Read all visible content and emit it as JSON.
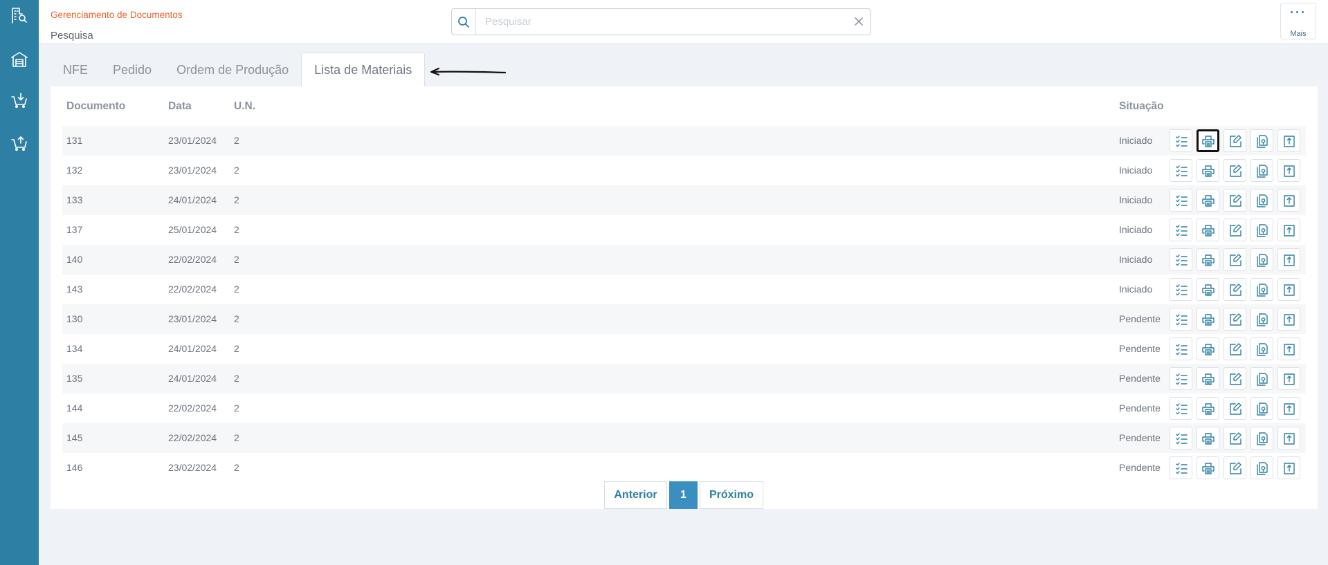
{
  "sidebar": {
    "items": [
      {
        "icon": "building-search-icon"
      },
      {
        "icon": "warehouse-icon"
      },
      {
        "icon": "cart-download-icon"
      },
      {
        "icon": "cart-upload-icon"
      }
    ]
  },
  "header": {
    "app_title": "Gerenciamento de Documentos",
    "subtitle": "Pesquisa",
    "search_placeholder": "Pesquisar",
    "search_value": "",
    "more_dots": "···",
    "more_label": "Mais"
  },
  "tabs": [
    {
      "label": "NFE",
      "active": false
    },
    {
      "label": "Pedido",
      "active": false
    },
    {
      "label": "Ordem de Produção",
      "active": false
    },
    {
      "label": "Lista de Materiais",
      "active": true
    }
  ],
  "table": {
    "columns": {
      "doc": "Documento",
      "date": "Data",
      "un": "U.N.",
      "sit": "Situação"
    },
    "rows": [
      {
        "doc": "131",
        "date": "23/01/2024",
        "un": "2",
        "sit": "Iniciado"
      },
      {
        "doc": "132",
        "date": "23/01/2024",
        "un": "2",
        "sit": "Iniciado"
      },
      {
        "doc": "133",
        "date": "24/01/2024",
        "un": "2",
        "sit": "Iniciado"
      },
      {
        "doc": "137",
        "date": "25/01/2024",
        "un": "2",
        "sit": "Iniciado"
      },
      {
        "doc": "140",
        "date": "22/02/2024",
        "un": "2",
        "sit": "Iniciado"
      },
      {
        "doc": "143",
        "date": "22/02/2024",
        "un": "2",
        "sit": "Iniciado"
      },
      {
        "doc": "130",
        "date": "23/01/2024",
        "un": "2",
        "sit": "Pendente"
      },
      {
        "doc": "134",
        "date": "24/01/2024",
        "un": "2",
        "sit": "Pendente"
      },
      {
        "doc": "135",
        "date": "24/01/2024",
        "un": "2",
        "sit": "Pendente"
      },
      {
        "doc": "144",
        "date": "22/02/2024",
        "un": "2",
        "sit": "Pendente"
      },
      {
        "doc": "145",
        "date": "22/02/2024",
        "un": "2",
        "sit": "Pendente"
      },
      {
        "doc": "146",
        "date": "23/02/2024",
        "un": "2",
        "sit": "Pendente"
      }
    ],
    "row_actions": [
      "checklist-icon",
      "print-icon",
      "edit-icon",
      "copy-document-icon",
      "upload-icon"
    ]
  },
  "pagination": {
    "prev_label": "Anterior",
    "current_page": "1",
    "next_label": "Próximo"
  },
  "colors": {
    "sidebar": "#2d7fa3",
    "accent": "#2d7fa3",
    "app_title": "#e8622a",
    "page_active": "#3a8fc0"
  }
}
